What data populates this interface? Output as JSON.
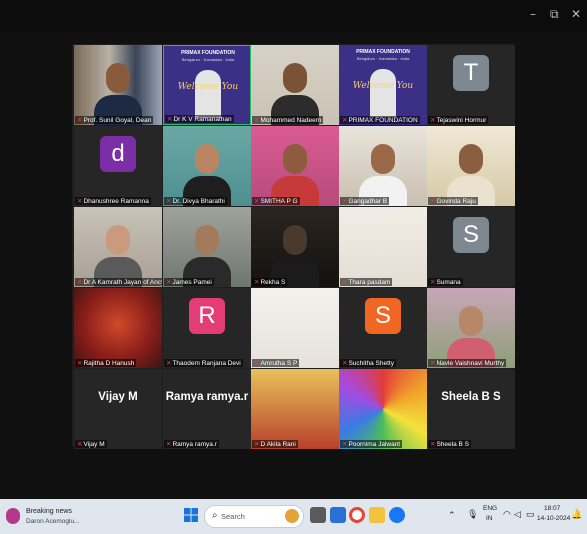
{
  "window": {
    "minimize": "–",
    "restore": "⧉",
    "close": "✕"
  },
  "colors": {
    "background": "#101010",
    "grid_bg": "#1e1e1e",
    "tile_bg": "#262626",
    "muted_mic": "#e0443b",
    "active_speaker": "#23c16b",
    "taskbar": "#dfe6ee"
  },
  "banner": {
    "org": "PRIMAX FOUNDATION",
    "tag": "Bengaluru · Karnataka · India",
    "welcome": "Welcome You"
  },
  "participants": [
    {
      "name": "Prof. Sunil Goyal, Dean",
      "type": "photo",
      "scene": "man-shelves"
    },
    {
      "name": "Dr K V Ramanathan",
      "type": "banner",
      "active": true
    },
    {
      "name": "Mohammed Nadeem",
      "type": "photo",
      "scene": "man-wall"
    },
    {
      "name": "PRIMAX FOUNDATION",
      "type": "banner"
    },
    {
      "name": "Tejaswini Hormur",
      "type": "avatar",
      "letter": "T",
      "color": "#7d8891"
    },
    {
      "name": "Dhanushree Ramanna",
      "type": "avatar",
      "letter": "d",
      "color": "#7b2ea6"
    },
    {
      "name": "Dr. Divya Bharathi",
      "type": "photo",
      "scene": "woman-teal"
    },
    {
      "name": "SMITHA P G",
      "type": "photo",
      "scene": "woman-pink"
    },
    {
      "name": "Gangadhar B",
      "type": "photo",
      "scene": "man-white"
    },
    {
      "name": "Govinda Raju",
      "type": "photo",
      "scene": "man-cream"
    },
    {
      "name": "Dr A Kamrath Jayan of Ancy",
      "type": "photo",
      "scene": "woman-glasses"
    },
    {
      "name": "James Pamei",
      "type": "photo",
      "scene": "man-glasses"
    },
    {
      "name": "Rekha S",
      "type": "photo",
      "scene": "dark"
    },
    {
      "name": "Thara pasdam",
      "type": "photo",
      "scene": "figurine"
    },
    {
      "name": "Sumana",
      "type": "avatar",
      "letter": "S",
      "color": "#7d8891"
    },
    {
      "name": "Rajitha D Hanush",
      "type": "photo",
      "scene": "art"
    },
    {
      "name": "Thaodem Ranjana Devi",
      "type": "avatar",
      "letter": "R",
      "color": "#e43d76"
    },
    {
      "name": "Amrutha S P",
      "type": "photo",
      "scene": "bird"
    },
    {
      "name": "Suchitha Shetty",
      "type": "avatar",
      "letter": "S",
      "color": "#f06623"
    },
    {
      "name": "Navle Vaishnavi Murthy",
      "type": "photo",
      "scene": "woman-garden"
    },
    {
      "name": "Vijay M",
      "type": "text",
      "display": "Vijay M"
    },
    {
      "name": "Ramya ramya.r",
      "type": "text",
      "display": "Ramya ramya.r"
    },
    {
      "name": "D Akila Rani",
      "type": "photo",
      "scene": "deity"
    },
    {
      "name": "Poornima Jalwant",
      "type": "photo",
      "scene": "rose"
    },
    {
      "name": "Sheela B S",
      "type": "text",
      "display": "Sheela B S"
    }
  ],
  "taskbar": {
    "news_title": "Breaking news",
    "news_sub": "Daron Acemoglu...",
    "search_placeholder": "Search",
    "lang_top": "ENG",
    "lang_bottom": "IN",
    "time": "18:07",
    "date": "14-10-2024"
  }
}
